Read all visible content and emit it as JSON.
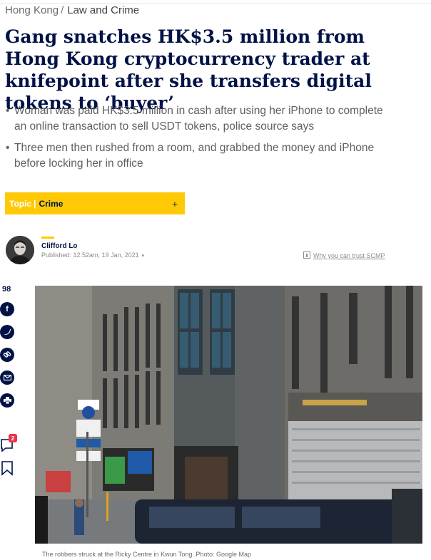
{
  "breadcrumb": {
    "section": "Hong Kong",
    "separator": "/",
    "subsection": "Law and Crime"
  },
  "headline": "Gang snatches HK$3.5 million from Hong Kong cryptocurrency trader at knifepoint after she transfers digital tokens to ‘buyer’",
  "summary": [
    "Woman was paid HK$3.5 million in cash after using her iPhone to complete an online transaction to sell USDT tokens, police source says",
    "Three men then rushed from a room, and grabbed the money and iPhone before locking her in office"
  ],
  "topic": {
    "label": "Topic",
    "separator": "|",
    "value": "Crime",
    "action_icon": "plus-icon"
  },
  "author": {
    "name": "Clifford Lo",
    "published": "Published: 12:52am, 19 Jan, 2021",
    "trust_link": "Why you can trust SCMP"
  },
  "sharing": {
    "count": "98",
    "buttons": [
      "facebook-icon",
      "twitter-icon",
      "link-icon",
      "email-icon",
      "print-icon"
    ],
    "comment_count": "2",
    "comment_icon": "comment-icon",
    "bookmark_icon": "bookmark-icon"
  },
  "photo": {
    "caption": "The robbers struck at the Ricky Centre in Kwun Tong. Photo: Google Map",
    "signage": [
      "7",
      "7",
      "P",
      "P"
    ]
  },
  "colors": {
    "brand_navy": "#001246",
    "topic_yellow": "#ffca05",
    "badge_red": "#e8334a"
  }
}
